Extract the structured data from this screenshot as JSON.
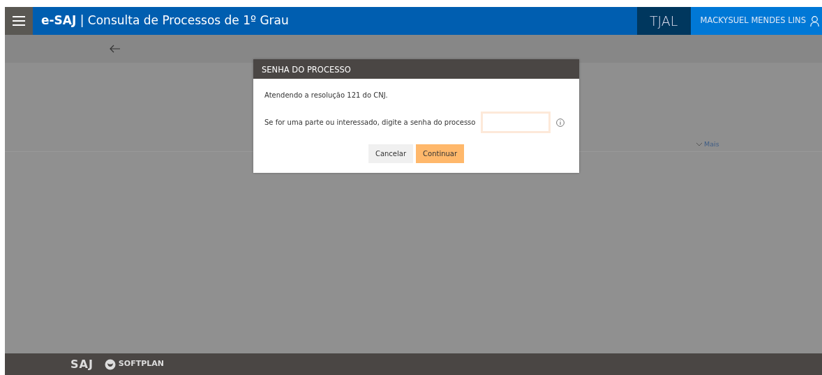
{
  "header": {
    "brand": "e-SAJ",
    "separator": "|",
    "title": "Consulta de Processos de 1º Grau",
    "court": "TJAL",
    "user": "MACKYSUEL MENDES LINS"
  },
  "more_link": "Mais",
  "dialog": {
    "title": "SENHA DO PROCESSO",
    "notice": "Atendendo a resolução 121 do CNJ.",
    "prompt": "Se for uma parte ou interessado, digite a senha do processo",
    "buttons": [
      {
        "label": "Cancelar",
        "kind": "secondary"
      },
      {
        "label": "Continuar",
        "kind": "primary"
      }
    ]
  },
  "footer": {
    "logos": [
      "SAJ",
      "SOFTPLAN"
    ]
  }
}
